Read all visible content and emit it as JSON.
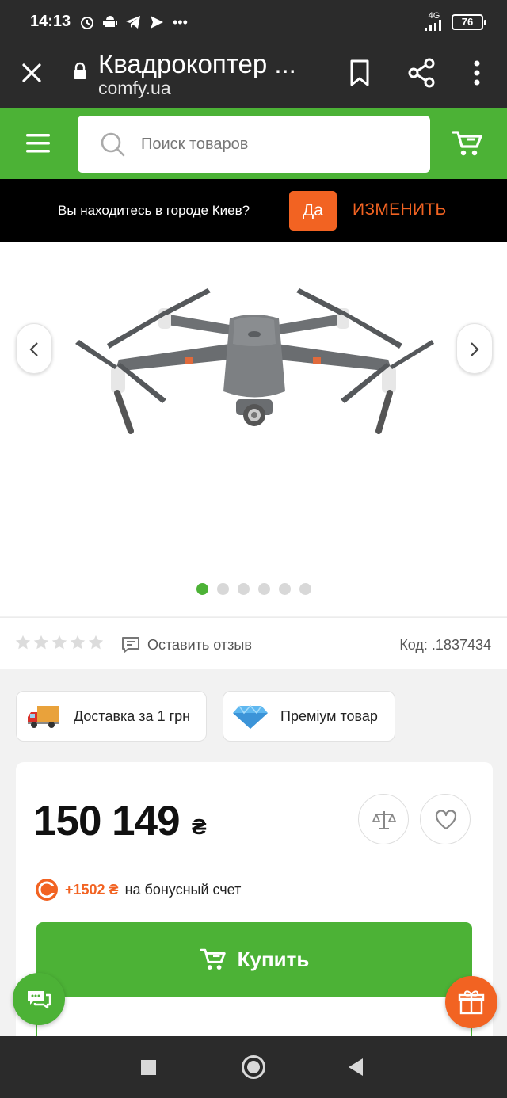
{
  "status_bar": {
    "time": "14:13",
    "network": "4G",
    "battery": "76",
    "icons": [
      "alarm-icon",
      "android-icon",
      "telegram-icon",
      "send-icon",
      "more-icon"
    ]
  },
  "browser": {
    "title": "Квадрокоптер ...",
    "domain": "comfy.ua"
  },
  "header": {
    "search_placeholder": "Поиск товаров",
    "brand_color": "#4cb236"
  },
  "city_banner": {
    "question": "Вы находитесь в городе Киев?",
    "yes_label": "Да",
    "change_label": "ИЗМЕНИТЬ",
    "accent_color": "#f26322"
  },
  "gallery": {
    "image_name": "drone",
    "dot_count": 6,
    "active_dot": 0
  },
  "product": {
    "rating": 0,
    "rating_max": 5,
    "review_label": "Оставить отзыв",
    "code": "Код: .1837434"
  },
  "badges": [
    {
      "label": "Доставка за 1 грн",
      "icon": "delivery-truck-icon"
    },
    {
      "label": "Преміум товар",
      "icon": "diamond-icon"
    }
  ],
  "price": {
    "amount": "150 149",
    "currency": "₴",
    "bonus_amount": "+1502 ₴",
    "bonus_text": "на бонусный счет",
    "buy_label": "Купить"
  }
}
